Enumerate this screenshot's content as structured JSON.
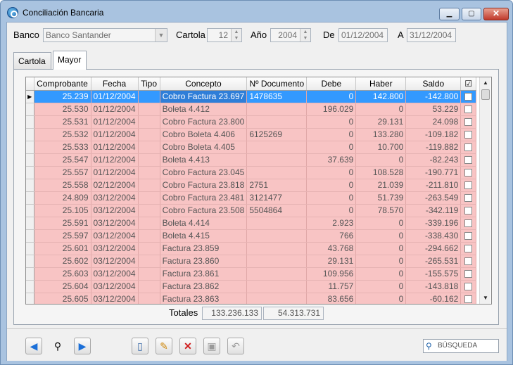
{
  "window": {
    "title": "Conciliación Bancaria"
  },
  "filters": {
    "banco_label": "Banco",
    "banco_value": "Banco Santander",
    "cartola_label": "Cartola",
    "cartola_value": "12",
    "anio_label": "Año",
    "anio_value": "2004",
    "de_label": "De",
    "de_value": "01/12/2004",
    "a_label": "A",
    "a_value": "31/12/2004"
  },
  "tabs": [
    {
      "label": "Cartola"
    },
    {
      "label": "Mayor"
    }
  ],
  "grid": {
    "columns": [
      "Comprobante",
      "Fecha",
      "Tipo",
      "Concepto",
      "Nº Documento",
      "Debe",
      "Haber",
      "Saldo",
      "☑"
    ],
    "rows": [
      {
        "comprobante": "25.239",
        "fecha": "01/12/2004",
        "tipo": "",
        "concepto": "Cobro Factura 23.697",
        "documento": "1478635",
        "debe": "0",
        "haber": "142.800",
        "saldo": "-142.800"
      },
      {
        "comprobante": "25.530",
        "fecha": "01/12/2004",
        "tipo": "",
        "concepto": "Boleta 4.412",
        "documento": "",
        "debe": "196.029",
        "haber": "0",
        "saldo": "53.229"
      },
      {
        "comprobante": "25.531",
        "fecha": "01/12/2004",
        "tipo": "",
        "concepto": "Cobro Factura 23.800",
        "documento": "",
        "debe": "0",
        "haber": "29.131",
        "saldo": "24.098"
      },
      {
        "comprobante": "25.532",
        "fecha": "01/12/2004",
        "tipo": "",
        "concepto": "Cobro Boleta 4.406",
        "documento": "6125269",
        "debe": "0",
        "haber": "133.280",
        "saldo": "-109.182"
      },
      {
        "comprobante": "25.533",
        "fecha": "01/12/2004",
        "tipo": "",
        "concepto": "Cobro Boleta 4.405",
        "documento": "",
        "debe": "0",
        "haber": "10.700",
        "saldo": "-119.882"
      },
      {
        "comprobante": "25.547",
        "fecha": "01/12/2004",
        "tipo": "",
        "concepto": "Boleta 4.413",
        "documento": "",
        "debe": "37.639",
        "haber": "0",
        "saldo": "-82.243"
      },
      {
        "comprobante": "25.557",
        "fecha": "01/12/2004",
        "tipo": "",
        "concepto": "Cobro Factura 23.045",
        "documento": "",
        "debe": "0",
        "haber": "108.528",
        "saldo": "-190.771"
      },
      {
        "comprobante": "25.558",
        "fecha": "02/12/2004",
        "tipo": "",
        "concepto": "Cobro Factura 23.818",
        "documento": "2751",
        "debe": "0",
        "haber": "21.039",
        "saldo": "-211.810"
      },
      {
        "comprobante": "24.809",
        "fecha": "03/12/2004",
        "tipo": "",
        "concepto": "Cobro Factura 23.481",
        "documento": "3121477",
        "debe": "0",
        "haber": "51.739",
        "saldo": "-263.549"
      },
      {
        "comprobante": "25.105",
        "fecha": "03/12/2004",
        "tipo": "",
        "concepto": "Cobro Factura 23.508",
        "documento": "5504864",
        "debe": "0",
        "haber": "78.570",
        "saldo": "-342.119"
      },
      {
        "comprobante": "25.591",
        "fecha": "03/12/2004",
        "tipo": "",
        "concepto": "Boleta 4.414",
        "documento": "",
        "debe": "2.923",
        "haber": "0",
        "saldo": "-339.196"
      },
      {
        "comprobante": "25.597",
        "fecha": "03/12/2004",
        "tipo": "",
        "concepto": "Boleta 4.415",
        "documento": "",
        "debe": "766",
        "haber": "0",
        "saldo": "-338.430"
      },
      {
        "comprobante": "25.601",
        "fecha": "03/12/2004",
        "tipo": "",
        "concepto": "Factura 23.859",
        "documento": "",
        "debe": "43.768",
        "haber": "0",
        "saldo": "-294.662"
      },
      {
        "comprobante": "25.602",
        "fecha": "03/12/2004",
        "tipo": "",
        "concepto": "Factura 23.860",
        "documento": "",
        "debe": "29.131",
        "haber": "0",
        "saldo": "-265.531"
      },
      {
        "comprobante": "25.603",
        "fecha": "03/12/2004",
        "tipo": "",
        "concepto": "Factura 23.861",
        "documento": "",
        "debe": "109.956",
        "haber": "0",
        "saldo": "-155.575"
      },
      {
        "comprobante": "25.604",
        "fecha": "03/12/2004",
        "tipo": "",
        "concepto": "Factura 23.862",
        "documento": "",
        "debe": "11.757",
        "haber": "0",
        "saldo": "-143.818"
      },
      {
        "comprobante": "25.605",
        "fecha": "03/12/2004",
        "tipo": "",
        "concepto": "Factura 23.863",
        "documento": "",
        "debe": "83.656",
        "haber": "0",
        "saldo": "-60.162"
      }
    ]
  },
  "totals": {
    "label": "Totales",
    "debe": "133.236.133",
    "haber": "54.313.731"
  },
  "toolbar": {
    "search_placeholder": "BÚSQUEDA"
  },
  "colors": {
    "row_bg": "#f8c4c4",
    "selected_bg": "#3399ff",
    "frame": "#a9c3e0"
  }
}
